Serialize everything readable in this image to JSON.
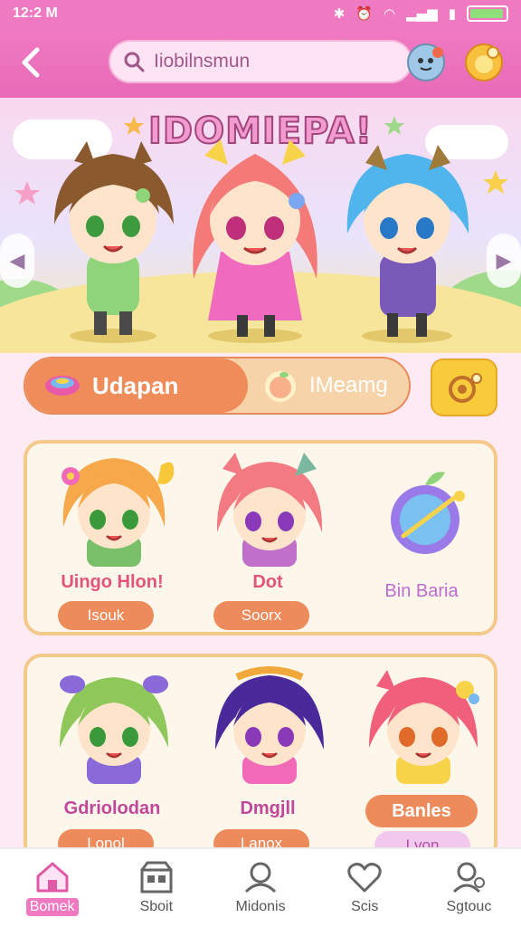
{
  "status_bar": {
    "time": "12:2 M",
    "signal_text": "ℬ"
  },
  "header": {
    "search_text": "Iiobilnsmun"
  },
  "banner": {
    "title": "IDOMIEPA!"
  },
  "tabs": {
    "active_label": "Udapan",
    "inactive_label": "IMeamg"
  },
  "panel1": {
    "cards": [
      {
        "name": "Uingo Hlon!",
        "button": "Isouk"
      },
      {
        "name": "Dot",
        "button": "Soorx"
      },
      {
        "name": "Bin Baria"
      }
    ]
  },
  "panel2": {
    "cards": [
      {
        "name": "Gdriolodan",
        "button": "Lonol"
      },
      {
        "name": "Dmgjll",
        "button": "Lanox"
      },
      {
        "name": "Banles",
        "button": "Lvon"
      }
    ]
  },
  "bottom_nav": {
    "items": [
      {
        "label": "Bomek",
        "icon": "home-icon"
      },
      {
        "label": "Sboit",
        "icon": "shop-icon"
      },
      {
        "label": "Midonis",
        "icon": "character-icon"
      },
      {
        "label": "Scis",
        "icon": "heart-icon"
      },
      {
        "label": "Sgtouc",
        "icon": "profile-icon"
      }
    ]
  },
  "colors": {
    "accent": "#f07ac2",
    "orange": "#ee8b5c",
    "yellow": "#f8cb3b"
  }
}
